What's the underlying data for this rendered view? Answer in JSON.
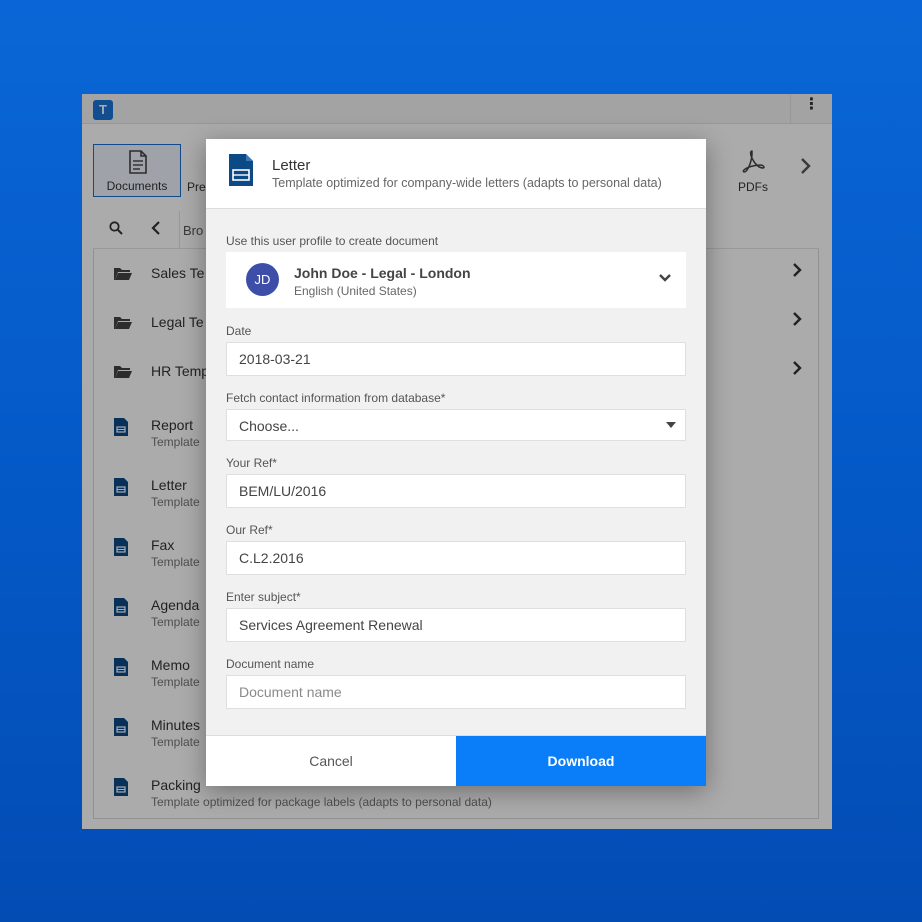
{
  "app": {
    "logo_letter": "T",
    "menu_glyph": "⋮",
    "ribbon": {
      "tabs": [
        {
          "label": "Documents",
          "icon": "document-icon",
          "active": true
        },
        {
          "label": "Pre",
          "icon": "presentation-icon",
          "active": false
        },
        {
          "label": "PDFs",
          "icon": "acrobat-icon",
          "active": false
        }
      ]
    },
    "toolbar": {
      "browse_label": "Bro"
    },
    "list": [
      {
        "title": "Sales Te",
        "subtitle": "",
        "type": "folder"
      },
      {
        "title": "Legal Te",
        "subtitle": "",
        "type": "folder"
      },
      {
        "title": "HR Temp",
        "subtitle": "",
        "type": "folder"
      },
      {
        "title": "Report",
        "subtitle": "Template",
        "type": "document"
      },
      {
        "title": "Letter",
        "subtitle": "Template",
        "type": "document"
      },
      {
        "title": "Fax",
        "subtitle": "Template",
        "type": "document"
      },
      {
        "title": "Agenda",
        "subtitle": "Template",
        "type": "document"
      },
      {
        "title": "Memo",
        "subtitle": "Template",
        "type": "document"
      },
      {
        "title": "Minutes",
        "subtitle": "Template",
        "type": "document"
      },
      {
        "title": "Packing",
        "subtitle": "Template optimized for package labels (adapts to personal data)",
        "type": "document"
      }
    ]
  },
  "modal": {
    "title": "Letter",
    "subtitle": "Template optimized for company-wide letters (adapts to personal data)",
    "profile": {
      "label": "Use this user profile to create document",
      "initials": "JD",
      "name": "John Doe - Legal - London",
      "locale": "English (United States)"
    },
    "date": {
      "label": "Date",
      "value": "2018-03-21"
    },
    "contact": {
      "label": "Fetch contact information from database*",
      "value": "Choose..."
    },
    "your_ref": {
      "label": "Your Ref*",
      "value": "BEM/LU/2016"
    },
    "our_ref": {
      "label": "Our Ref*",
      "value": "C.L2.2016"
    },
    "subject": {
      "label": "Enter subject*",
      "value": "Services Agreement Renewal"
    },
    "doc_name": {
      "label": "Document name",
      "value": "",
      "placeholder": "Document name"
    },
    "cancel_label": "Cancel",
    "download_label": "Download"
  },
  "colors": {
    "background": "#0458c6",
    "primary_button": "#0a7ef8",
    "avatar": "#3d4ea8",
    "doc_icon": "#0c4a86"
  }
}
